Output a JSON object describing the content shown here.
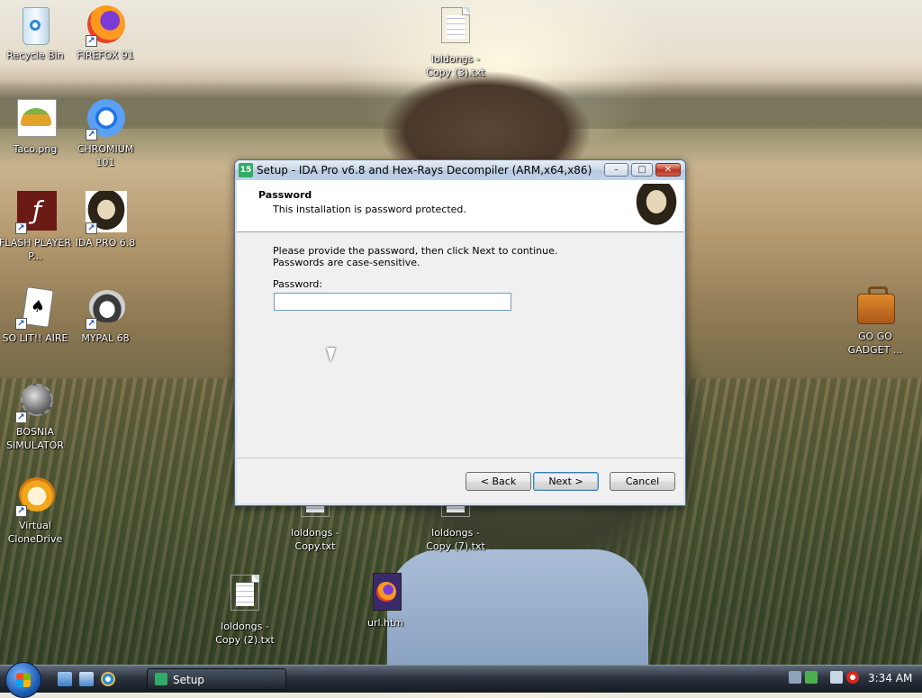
{
  "desktop": {
    "icons": [
      {
        "label": "Recycle Bin",
        "icon": "recycle-bin-icon"
      },
      {
        "label": "FIREFOX 91",
        "icon": "firefox-icon"
      },
      {
        "label": "loldongs - Copy (3).txt",
        "icon": "text-file-icon"
      },
      {
        "label": "Taco.png",
        "icon": "taco-image-icon"
      },
      {
        "label": "CHROMIUM 101",
        "icon": "chromium-icon"
      },
      {
        "label": "FLASH PLAYER P...",
        "icon": "flash-player-icon"
      },
      {
        "label": "IDA PRO 6.8",
        "icon": "ida-pro-icon"
      },
      {
        "label": "SO LIT!! AIRE",
        "icon": "solitaire-icon"
      },
      {
        "label": "MYPAL 68",
        "icon": "mypal-icon"
      },
      {
        "label": "BOSNIA SIMULATOR",
        "icon": "bosnia-simulator-icon"
      },
      {
        "label": "Virtual CloneDrive",
        "icon": "virtual-clonedrive-icon"
      },
      {
        "label": "loldongs - Copy.txt",
        "icon": "text-file-icon"
      },
      {
        "label": "loldongs - Copy (7).txt",
        "icon": "text-file-icon"
      },
      {
        "label": "loldongs - Copy (2).txt",
        "icon": "text-file-icon"
      },
      {
        "label": "url.htm",
        "icon": "html-file-icon"
      },
      {
        "label": "GO GO GADGET ...",
        "icon": "gadget-briefcase-icon"
      }
    ]
  },
  "dialog": {
    "title": "Setup - IDA Pro v6.8 and Hex-Rays Decompiler (ARM,x64,x86)",
    "app_icon_text": "15",
    "header_title": "Password",
    "header_subtitle": "This installation is password protected.",
    "description": "Please provide the password, then click Next to continue. Passwords are case-sensitive.",
    "password_label": "Password:",
    "password_value": "",
    "buttons": {
      "back": "< Back",
      "next": "Next >",
      "cancel": "Cancel"
    },
    "window_controls": {
      "minimize": "–",
      "maximize": "□",
      "close": "✕"
    }
  },
  "taskbar": {
    "task_label": "Setup",
    "clock": "3:34 AM"
  }
}
